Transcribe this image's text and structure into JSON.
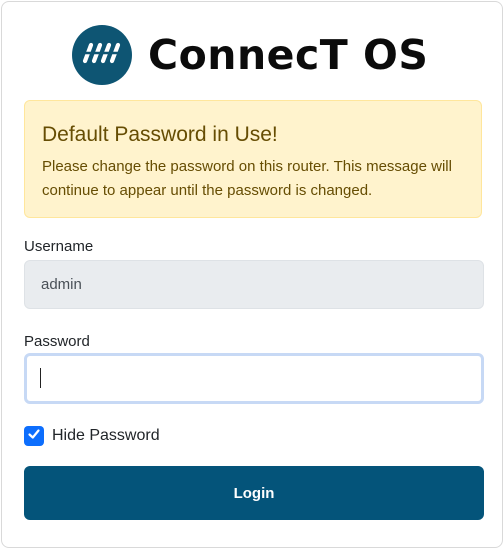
{
  "brand": {
    "name": "ConnecT OS",
    "logo_icon": "wave-icon",
    "logo_color": "#0e5573"
  },
  "alert": {
    "title": "Default Password in Use!",
    "message": "Please change the password on this router. This message will continue to appear until the password is changed.",
    "bg_color": "#fff3cd",
    "text_color": "#664d03"
  },
  "form": {
    "username_label": "Username",
    "username_value": "admin",
    "password_label": "Password",
    "password_value": "",
    "hide_password_label": "Hide Password",
    "hide_password_checked": true,
    "login_label": "Login",
    "login_color": "#04547a",
    "checkbox_color": "#0d6efd"
  }
}
